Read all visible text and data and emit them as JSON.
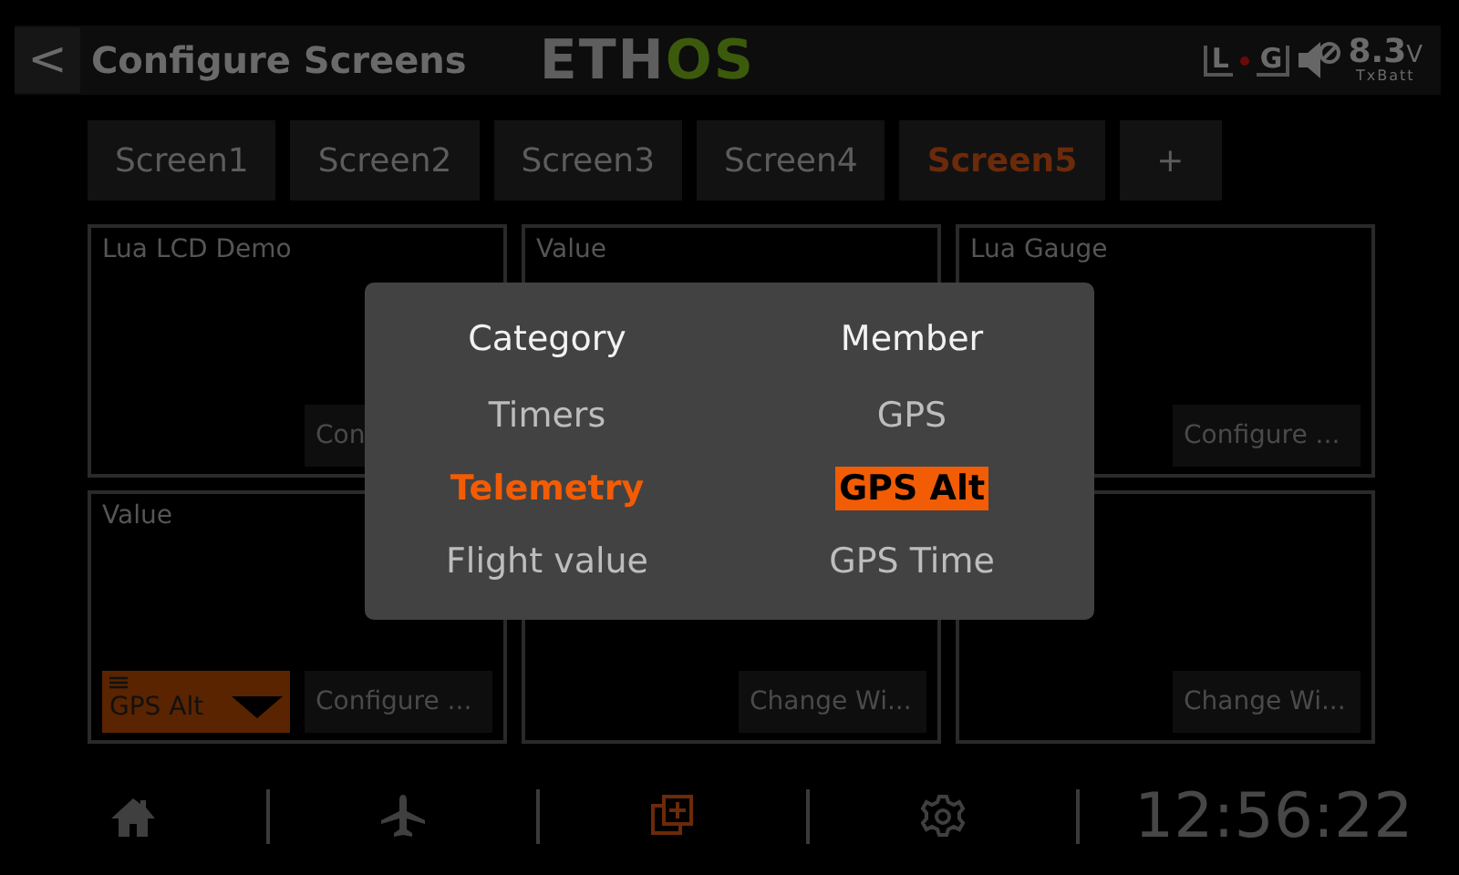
{
  "header": {
    "back": "<",
    "title": "Configure Screens",
    "logo": [
      {
        "text": "ETH",
        "color": "#5e5e5e"
      },
      {
        "text": "OS",
        "color": "#3c5a0c"
      }
    ],
    "status": {
      "left": "L",
      "right": "G",
      "voltage": "8.3",
      "unit": "V",
      "label": "TxBatt"
    }
  },
  "tabs": [
    {
      "label": "Screen1",
      "selected": false
    },
    {
      "label": "Screen2",
      "selected": false
    },
    {
      "label": "Screen3",
      "selected": false
    },
    {
      "label": "Screen4",
      "selected": false
    },
    {
      "label": "Screen5",
      "selected": true
    },
    {
      "label": "+",
      "selected": false
    }
  ],
  "widgets": [
    {
      "title": "Lua LCD Demo",
      "button": "Con"
    },
    {
      "title": "Value"
    },
    {
      "title": "Lua Gauge",
      "button": "Configure ..."
    },
    {
      "title": "Value",
      "source": "GPS Alt",
      "button": "Configure ..."
    },
    {
      "button": "Change Wi..."
    },
    {
      "button": "Change Wi..."
    }
  ],
  "popup": {
    "columns": [
      {
        "heading": "Category",
        "items": [
          {
            "label": "Timers",
            "selected": false
          },
          {
            "label": "Telemetry",
            "selected": true
          },
          {
            "label": "Flight value",
            "selected": false
          }
        ]
      },
      {
        "heading": "Member",
        "items": [
          {
            "label": "GPS",
            "selected": false
          },
          {
            "label": "GPS Alt",
            "selected": true
          },
          {
            "label": "GPS Time",
            "selected": false
          }
        ]
      }
    ]
  },
  "bottom_bar": {
    "items": [
      {
        "kind": "home",
        "selected": false
      },
      {
        "kind": "plane",
        "selected": false
      },
      {
        "kind": "screens",
        "selected": true
      },
      {
        "kind": "gear",
        "selected": false
      }
    ],
    "time": "12:56:22"
  }
}
